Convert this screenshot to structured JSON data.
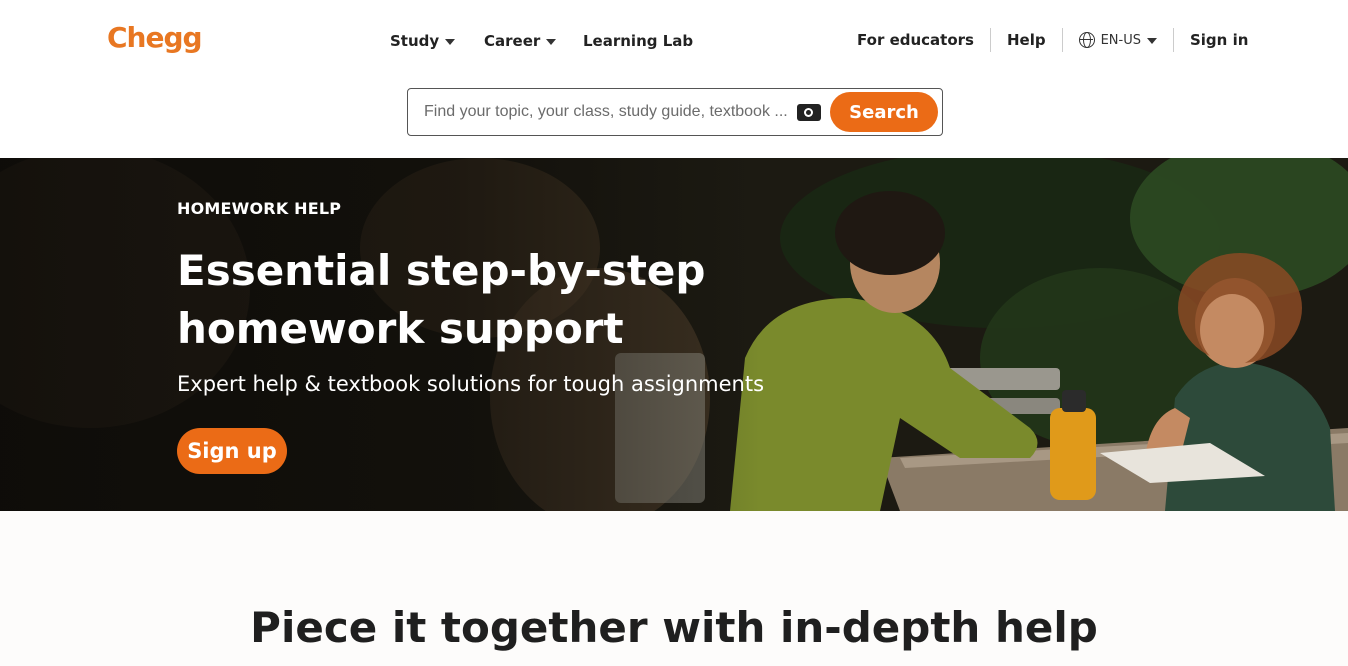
{
  "header": {
    "logo": "Chegg",
    "nav": [
      {
        "label": "Study"
      },
      {
        "label": "Career"
      },
      {
        "label": "Learning Lab"
      }
    ],
    "right": {
      "educators": "For educators",
      "help": "Help",
      "language": "EN-US",
      "signin": "Sign in"
    }
  },
  "search": {
    "placeholder": "Find your topic, your class, study guide, textbook ...",
    "button": "Search"
  },
  "hero": {
    "kicker": "HOMEWORK HELP",
    "headline": "Essential step-by-step homework support",
    "subhead": "Expert help & textbook solutions for tough assignments",
    "cta": "Sign up"
  },
  "section": {
    "title": "Piece it together with in-depth help"
  },
  "colors": {
    "brand_orange": "#eb6b16",
    "logo_orange": "#e87722"
  }
}
